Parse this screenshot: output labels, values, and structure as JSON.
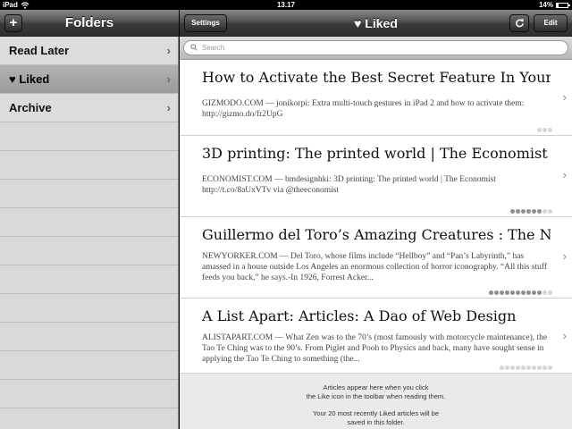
{
  "status_bar": {
    "device": "iPad",
    "time": "13.17",
    "battery_percent": 14,
    "battery_text": "14%"
  },
  "folders_panel": {
    "title": "Folders",
    "add_label": "+",
    "items": [
      {
        "label": "Read Later",
        "selected": false
      },
      {
        "label": "♥ Liked",
        "selected": true
      },
      {
        "label": "Archive",
        "selected": false
      }
    ]
  },
  "toolbar": {
    "settings_label": "Settings",
    "title": "♥ Liked",
    "refresh_icon": "refresh-icon",
    "edit_label": "Edit"
  },
  "search": {
    "placeholder": "Search"
  },
  "articles": [
    {
      "title": "How to Activate the Best Secret Feature In Your iP...",
      "source": "GIZMODO.COM",
      "description": " — jonikorpi: Extra multi-touch gestures in iPad 2 and how to activate them: http://gizmo.do/fr2UpG",
      "dots_total": 3,
      "dots_filled": 0
    },
    {
      "title": "3D printing: The printed world | The Economist",
      "source": "ECONOMIST.COM",
      "description": " — bmdesignhki: 3D printing: The printed world | The Economist http://t.co/8aUxVTv via @theeconomist",
      "dots_total": 8,
      "dots_filled": 6
    },
    {
      "title": "Guillermo del Toro’s Amazing Creatures : The Ne...",
      "source": "NEWYORKER.COM",
      "description": " — Del Toro, whose films include “Hellboy” and “Pan’s Labyrinth,” has amassed in a house outside Los Angeles an enormous collection of horror iconography. “All this stuff feeds you back,” he says.-In 1926, Forrest Acker...",
      "dots_total": 12,
      "dots_filled": 10
    },
    {
      "title": "A List Apart: Articles: A Dao of Web Design",
      "source": "ALISTAPART.COM",
      "description": " — What Zen was to the 70’s (most famously with motorcycle maintenance), the Tao Te Ching was to the 90’s. From Piglet and Pooh to Physics and back, many have sought sense in applying the Tao Te Ching to something (the...",
      "dots_total": 10,
      "dots_filled": 0
    }
  ],
  "footer": {
    "line1": "Articles appear here when you click",
    "line2": "the Like icon in the toolbar when reading them.",
    "line3": "Your 20 most recently Liked articles will be",
    "line4": "saved in this folder."
  }
}
